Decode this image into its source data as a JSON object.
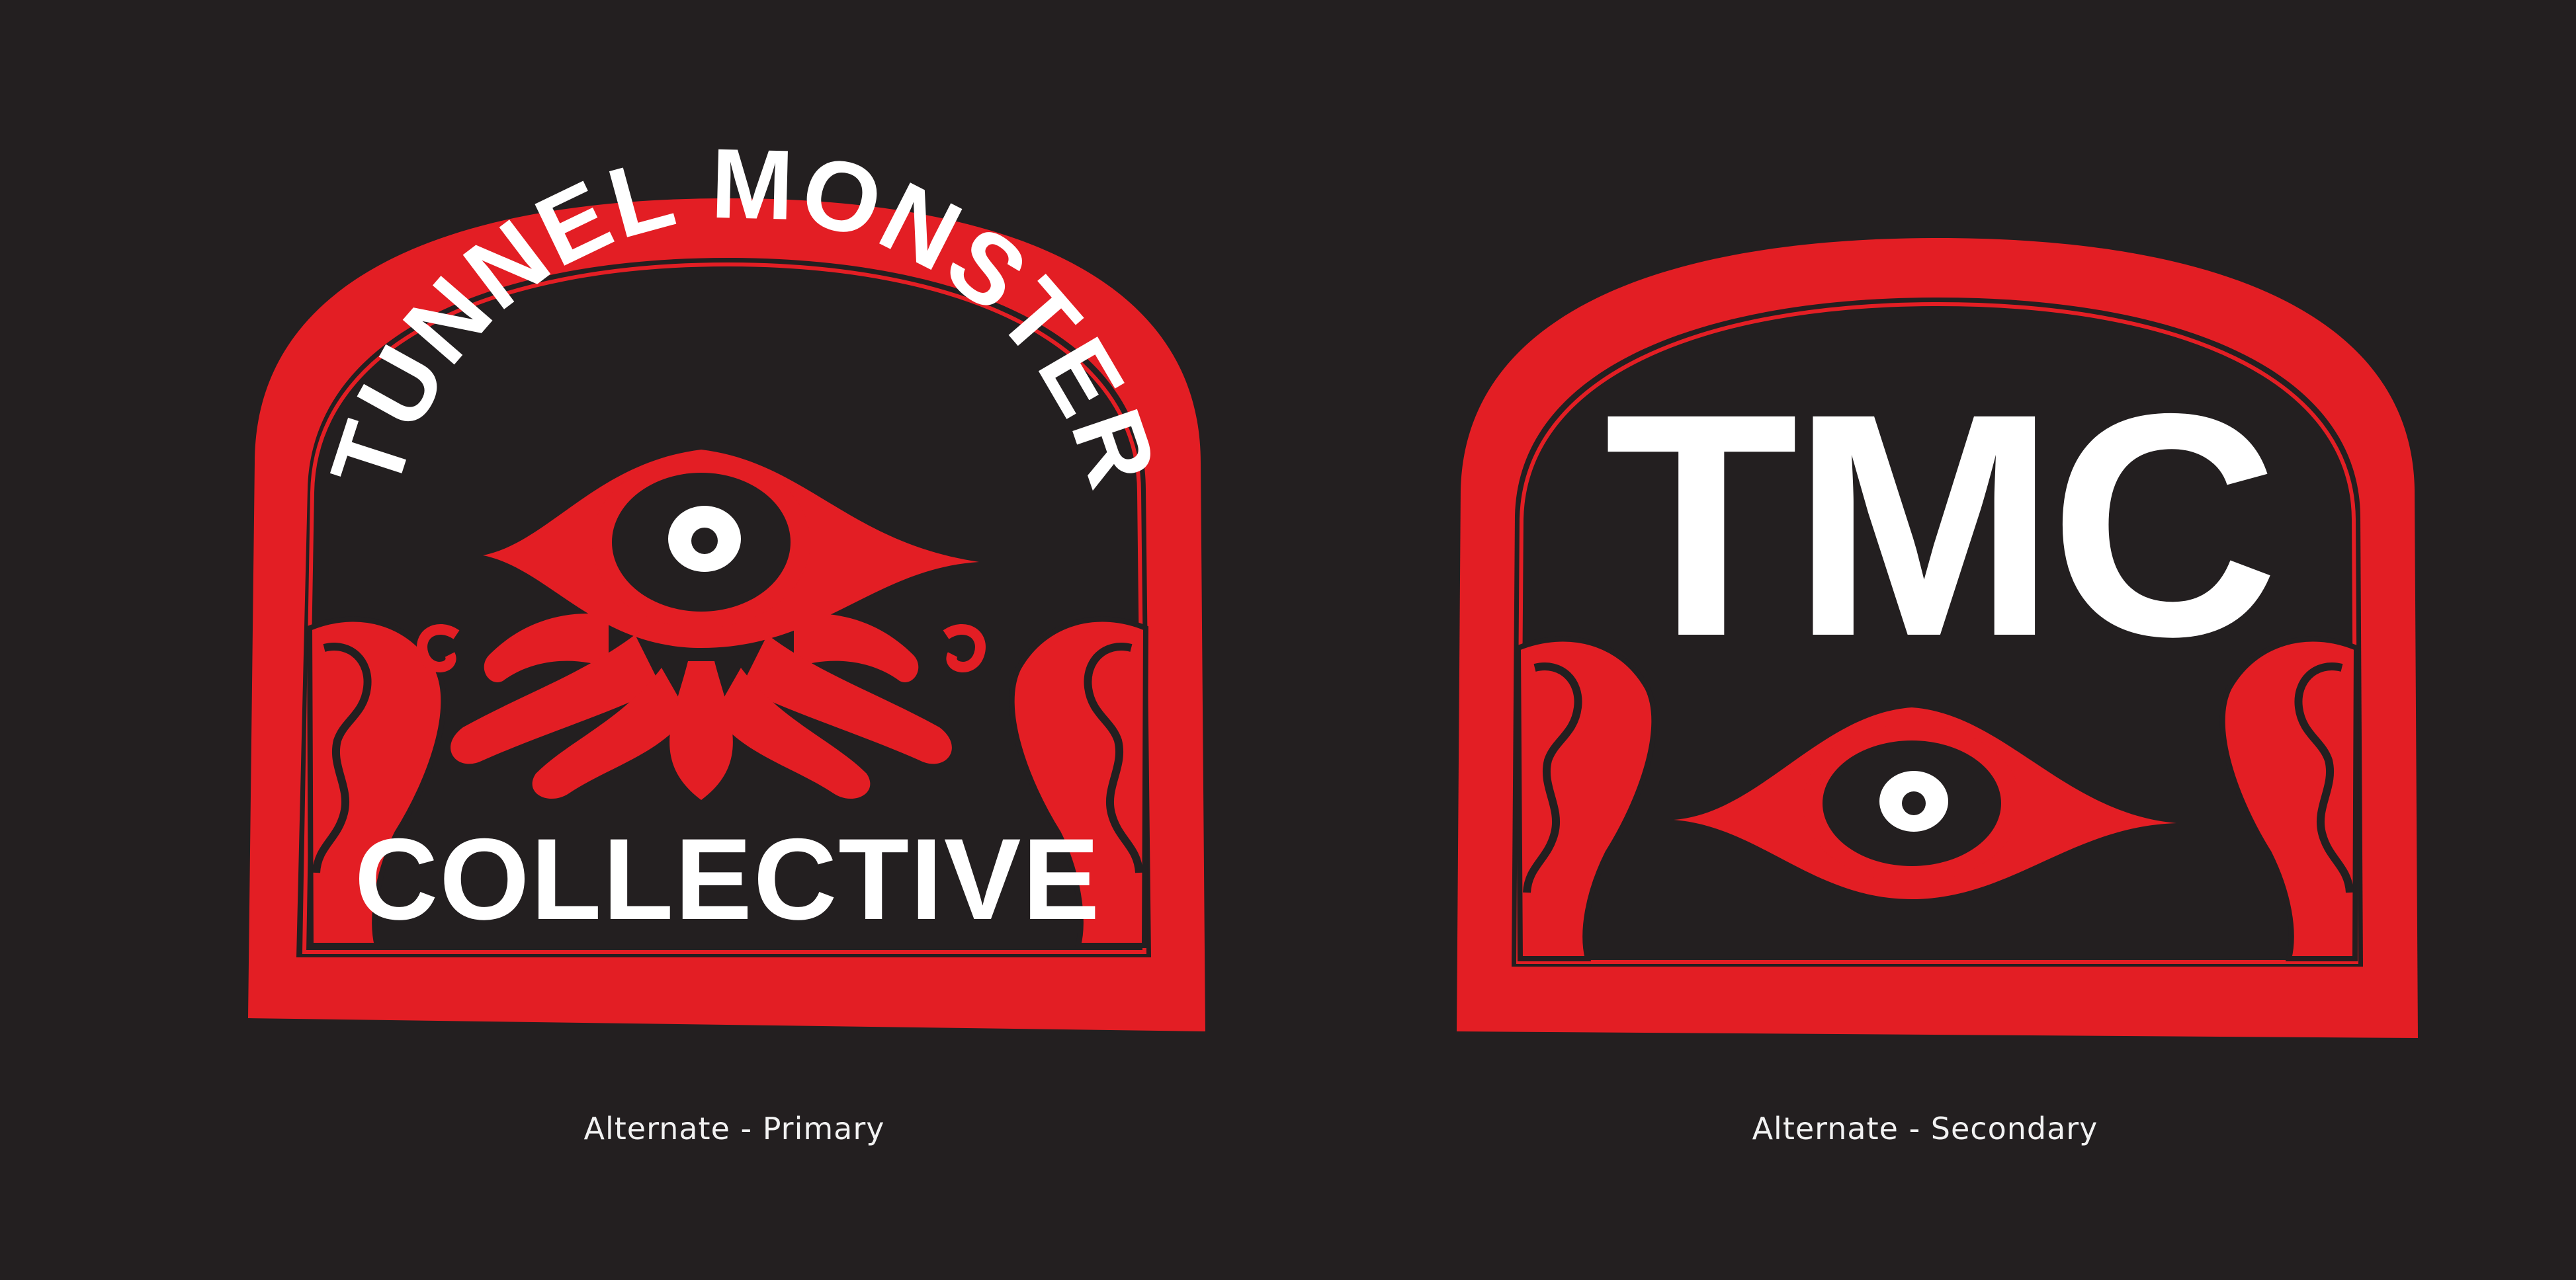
{
  "colors": {
    "background": "#231f20",
    "accent_red": "#e31e24",
    "white": "#ffffff"
  },
  "badges": [
    {
      "arc_text": "TUNNEL MONSTER",
      "bottom_text": "COLLECTIVE",
      "caption": "Alternate - Primary"
    },
    {
      "monogram": "TMC",
      "caption": "Alternate - Secondary"
    }
  ]
}
